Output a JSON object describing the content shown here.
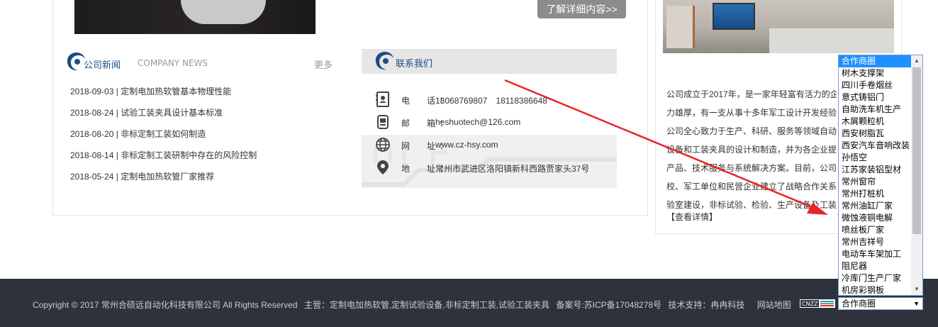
{
  "top": {
    "more_detail_button": "了解详细内容>>"
  },
  "news": {
    "title": "公司新闻",
    "title_en": "COMPANY NEWS",
    "more": "更多",
    "items": [
      {
        "date": "2018-09-03",
        "title": "定制电加热软管基本物理性能"
      },
      {
        "date": "2018-08-24",
        "title": "试验工装夹具设计基本标准"
      },
      {
        "date": "2018-08-20",
        "title": "非标定制工装如何制造"
      },
      {
        "date": "2018-08-14",
        "title": "非标定制工装研制中存在的风险控制"
      },
      {
        "date": "2018-05-24",
        "title": "定制电加热软管厂家推荐"
      }
    ]
  },
  "contact": {
    "title": "联系我们",
    "rows": [
      {
        "icon": "phone-book-icon",
        "label": "电　话：",
        "value": "18068769807　18118386648"
      },
      {
        "icon": "mail-icon",
        "label": "邮　箱：",
        "value": "heshuotech@126.com"
      },
      {
        "icon": "globe-icon",
        "label": "网　址：",
        "value": "www.cz-hsy.com"
      },
      {
        "icon": "location-pin-icon",
        "label": "地　址：",
        "value": "常州市武进区洛阳镇新科西路贾家头37号"
      }
    ]
  },
  "about": {
    "lines": [
      "公司成立于2017年，是一家年轻富有活力的企",
      "力雄厚，有一支从事十多年军工设计开发经验的",
      "公司全心致力于生产、科研、服务等领域自动化",
      "设备和工装夹具的设计和制造，并为各企业提供",
      "产品、技术服务与系统解决方案。目前，公司已",
      "校、军工单位和民营企业建立了战略合作关系，",
      "验室建设，非标试验、检验、生产设备及工装夹"
    ],
    "view_detail": "【查看详情】"
  },
  "footer": {
    "copyright": "Copyright © 2017 常州合硕远自动化科技有限公司 All Rights Reserved",
    "business": "主营：定制电加热软管,定制试验设备,非标定制工装,试验工装夹具",
    "icp": "备案号:苏ICP备17048278号",
    "tech_support": "技术支持：冉冉科技",
    "sitemap": "网站地图",
    "cnzz": "CNZZ"
  },
  "partner_select": {
    "selected": "合作商圈",
    "options": [
      "合作商圈",
      "树木支撑架",
      "四川手卷烟丝",
      "意式铸铝门",
      "自助洗车机生产",
      "木屑颗粒机",
      "西安树脂瓦",
      "西安汽车音响改装",
      "孙悟空",
      "江苏家装铝型材",
      "常州窗帘",
      "常州打桩机",
      "常州油缸厂家",
      "微蚀液铜电解",
      "喷丝板厂家",
      "常州吉祥号",
      "电动车车架加工",
      "阻尼器",
      "冷库门生产厂家",
      "机房彩钢板"
    ]
  },
  "colors": {
    "accent_blue": "#1c4c86",
    "footer_bg": "#2d323c",
    "arrow_red": "#e8262a",
    "select_highlight": "#1e90ff"
  }
}
